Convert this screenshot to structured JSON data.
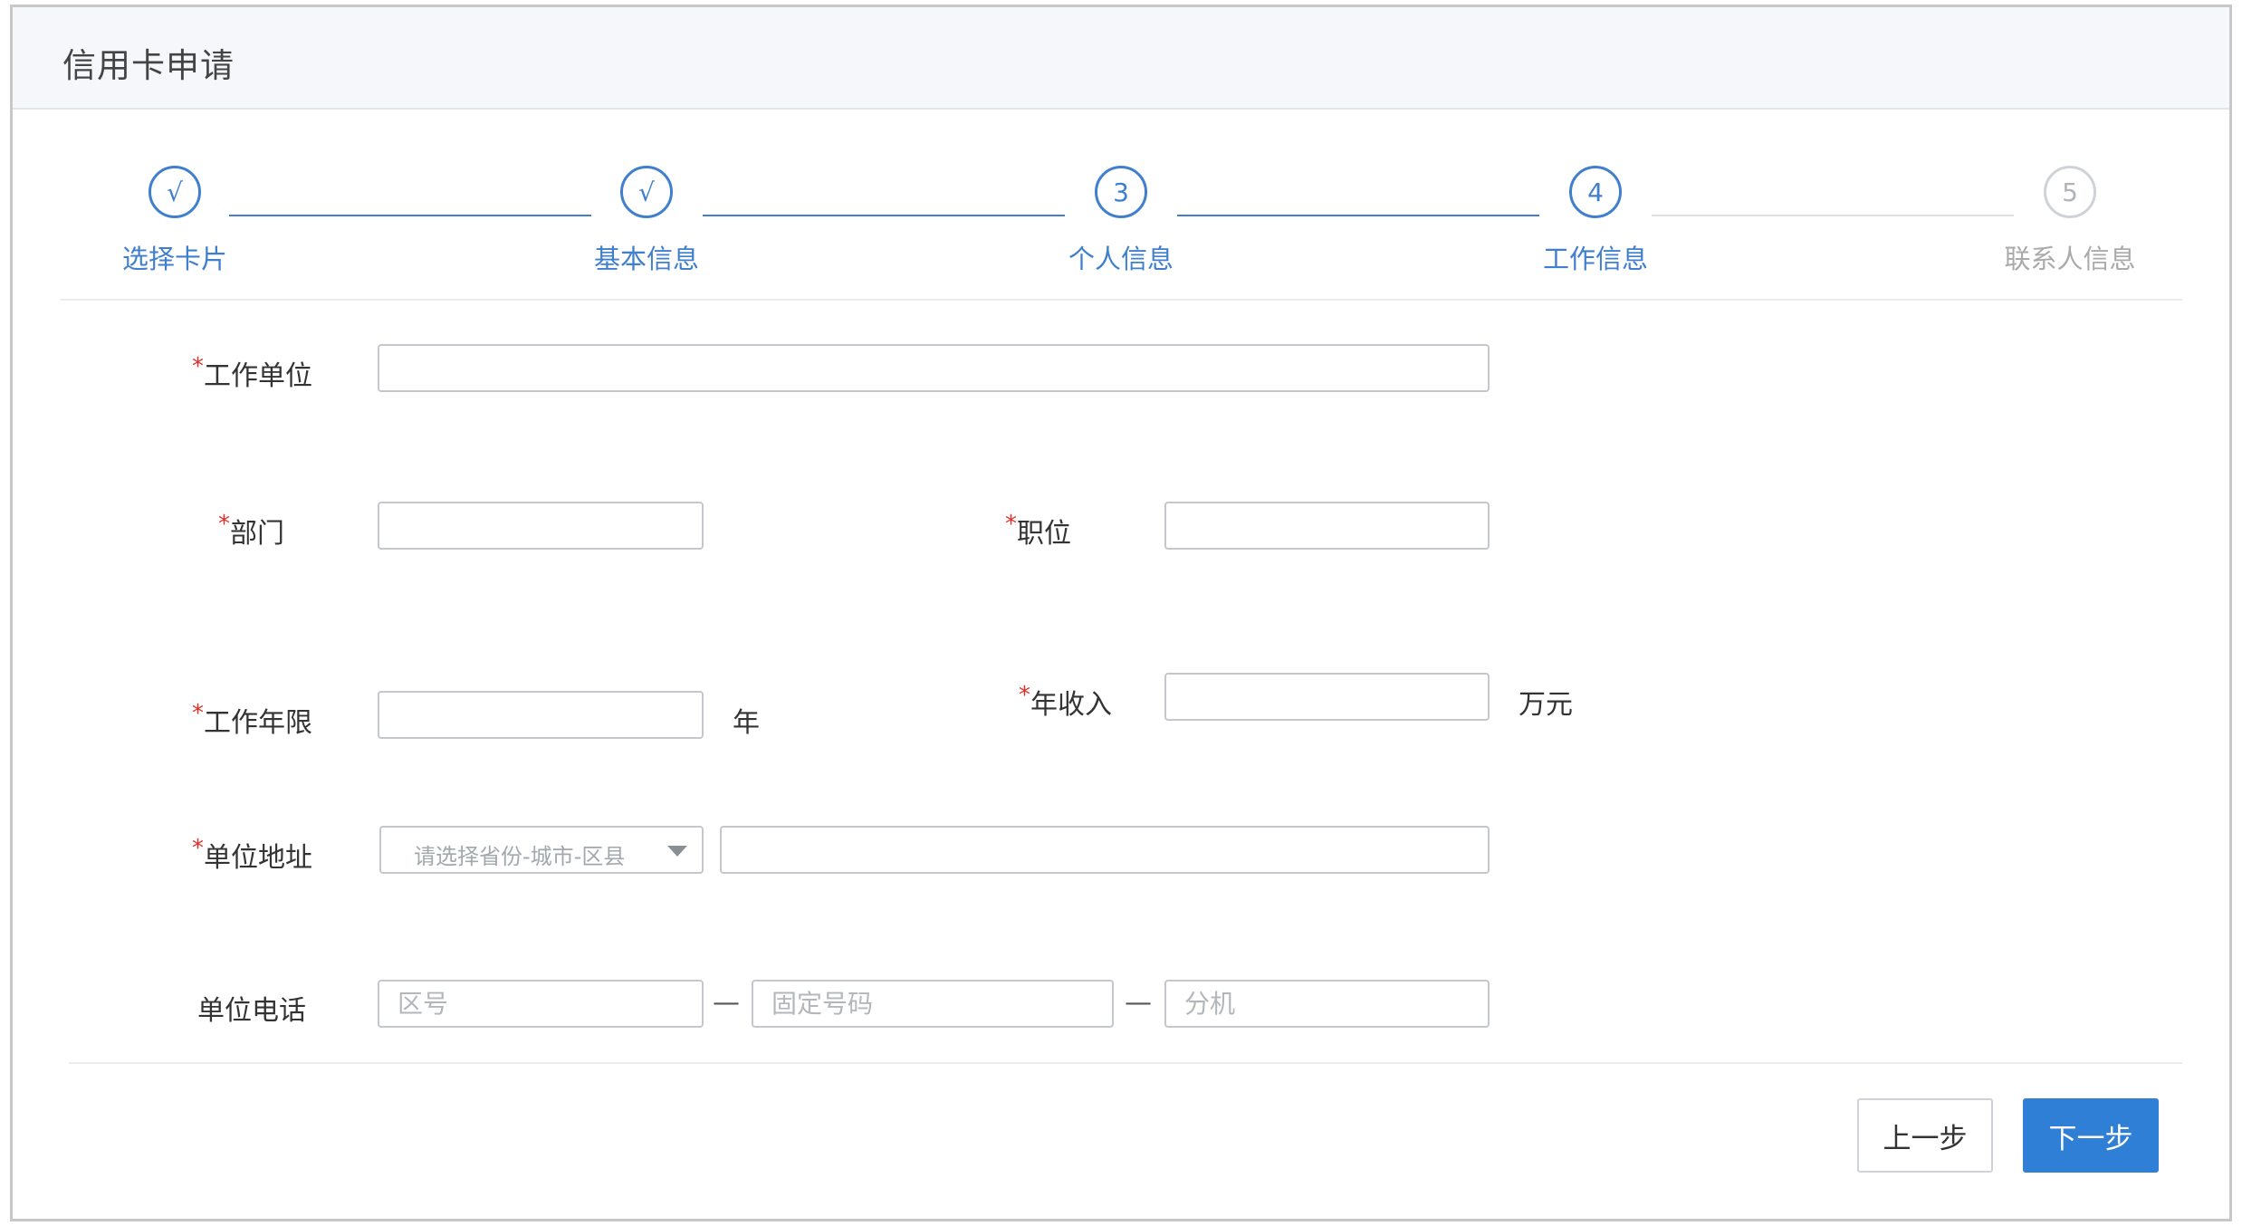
{
  "header": {
    "title": "信用卡申请"
  },
  "steps": [
    {
      "symbol": "√",
      "label": "选择卡片",
      "status": "done"
    },
    {
      "symbol": "√",
      "label": "基本信息",
      "status": "done"
    },
    {
      "symbol": "3",
      "label": "个人信息",
      "status": "done"
    },
    {
      "symbol": "4",
      "label": "工作信息",
      "status": "current"
    },
    {
      "symbol": "5",
      "label": "联系人信息",
      "status": "pending"
    }
  ],
  "form": {
    "required_mark": "*",
    "company": {
      "label": "工作单位",
      "value": ""
    },
    "department": {
      "label": "部门",
      "value": ""
    },
    "position": {
      "label": "职位",
      "value": ""
    },
    "years": {
      "label": "工作年限",
      "value": "",
      "unit": "年"
    },
    "income": {
      "label": "年收入",
      "value": "",
      "unit": "万元"
    },
    "address": {
      "label": "单位地址",
      "region_placeholder": "请选择省份-城市-区县",
      "detail_value": ""
    },
    "phone": {
      "label": "单位电话",
      "area_placeholder": "区号",
      "number_placeholder": "固定号码",
      "ext_placeholder": "分机",
      "separator": "—"
    }
  },
  "buttons": {
    "prev": "上一步",
    "next": "下一步"
  },
  "colors": {
    "accent": "#3f7fce",
    "primary_button": "#2f7fd6",
    "required": "#e0302a"
  }
}
